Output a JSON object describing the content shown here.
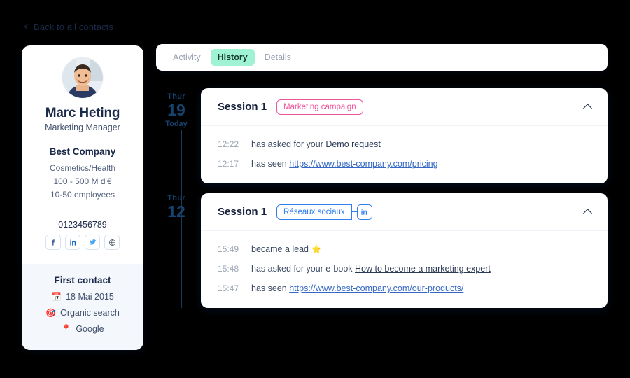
{
  "back_link": {
    "label": "Back to all contacts",
    "icon": "chevron-left-icon"
  },
  "contact": {
    "avatar_alt": "contact-photo",
    "name": "Marc Heting",
    "role": "Marketing Manager",
    "company": "Best Company",
    "industry": "Cosmetics/Health",
    "revenue": "100 - 500 M d'€",
    "employees": "10-50 employees",
    "phone": "0123456789",
    "socials": [
      {
        "name": "facebook-icon",
        "label": "f",
        "color": "#3b5998"
      },
      {
        "name": "linkedin-icon",
        "label": "in",
        "color": "#0a66c2"
      },
      {
        "name": "twitter-icon",
        "label": "twitter",
        "color": "#4aa8ef"
      },
      {
        "name": "website-icon",
        "label": "globe",
        "color": "#5a6878"
      }
    ],
    "first_contact": {
      "title": "First contact",
      "rows": [
        {
          "icon": "calendar-emoji",
          "emoji": "📅",
          "label": "18 Mai 2015"
        },
        {
          "icon": "target-emoji",
          "emoji": "🎯",
          "label": "Organic search"
        },
        {
          "icon": "pin-emoji",
          "emoji": "📍",
          "label": "Google"
        }
      ]
    }
  },
  "tabs": [
    {
      "label": "Activity",
      "active": false
    },
    {
      "label": "History",
      "active": true
    },
    {
      "label": "Details",
      "active": false
    }
  ],
  "markers": [
    {
      "dow": "Thur",
      "day": "19",
      "today": "Today"
    },
    {
      "dow": "Thur",
      "day": "12",
      "today": ""
    }
  ],
  "sessions": [
    {
      "title": "Session 1",
      "badge": {
        "label": "Marketing campaign",
        "color": "#f0559b",
        "style": "pink"
      },
      "channel_icon": "",
      "collapse_icon": "chevron-up-icon",
      "events": [
        {
          "time": "12:22",
          "prefix": "has asked for your ",
          "link": "Demo request",
          "link_style": "dark",
          "suffix": "",
          "emoji": ""
        },
        {
          "time": "12:17",
          "prefix": "has seen ",
          "link": "https://www.best-company.com/pricing",
          "link_style": "url",
          "suffix": "",
          "emoji": ""
        }
      ]
    },
    {
      "title": "Session 1",
      "badge": {
        "label": "Réseaux sociaux",
        "color": "#2f7ff0",
        "style": "blue"
      },
      "channel_icon": "linkedin-icon",
      "collapse_icon": "chevron-up-icon",
      "events": [
        {
          "time": "15:49",
          "prefix": "became a lead ",
          "link": "",
          "link_style": "",
          "suffix": "",
          "emoji": "⭐"
        },
        {
          "time": "15:48",
          "prefix": "has asked for your e-book ",
          "link": "How to become a marketing expert",
          "link_style": "dark",
          "suffix": "",
          "emoji": ""
        },
        {
          "time": "15:47",
          "prefix": "has seen ",
          "link": "https://www.best-company.com/our-products/",
          "link_style": "url",
          "suffix": "",
          "emoji": ""
        }
      ]
    }
  ],
  "colors": {
    "background": "#000000",
    "accent_mint": "#9ff2d4",
    "accent_pink": "#f0559b",
    "accent_blue": "#2f7ff0",
    "navy": "#1b2a4a"
  }
}
